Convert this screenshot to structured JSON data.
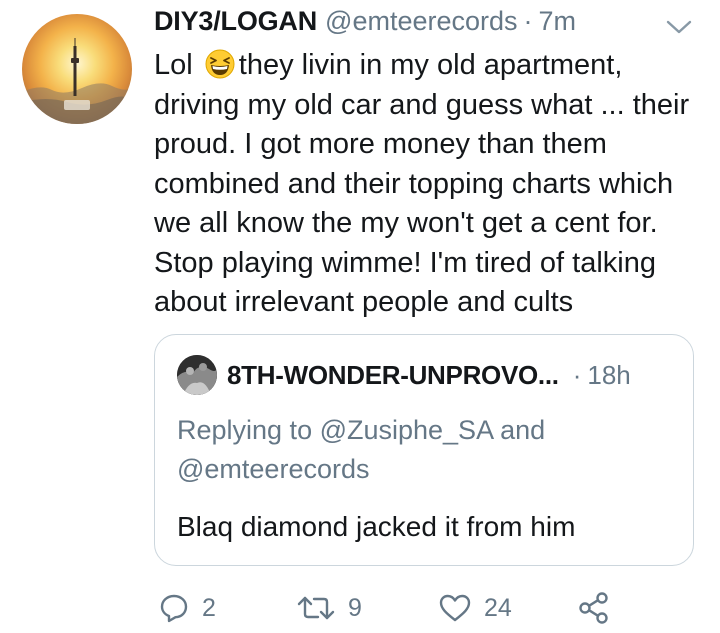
{
  "tweet": {
    "display_name": "DIY3/LOGAN",
    "handle": "@emteerecords",
    "separator": "·",
    "time": "7m",
    "text_before_emoji": "Lol",
    "emoji": "grinning-squinting-face-emoji",
    "text_after_emoji": "they livin in my old apartment, driving my old car and guess what ... their proud. I got more money than them combined and their topping charts which we all know the my won't get a cent for. Stop playing wimme! I'm tired of talking about irrelevant people and cults"
  },
  "quoted": {
    "display_name": "8TH-WONDER-UNPROVO...",
    "separator": "·",
    "time": "18h",
    "replying_line": "Replying to @Zusiphe_SA and @emteerecords",
    "text": "Blaq diamond jacked it from him"
  },
  "actions": {
    "reply_count": "2",
    "retweet_count": "9",
    "like_count": "24"
  },
  "icons": [
    "chevron-down-icon",
    "reply-icon",
    "retweet-icon",
    "like-icon",
    "share-icon"
  ],
  "colors": {
    "text": "#14171a",
    "muted": "#657786",
    "border": "#ccd6dd"
  }
}
